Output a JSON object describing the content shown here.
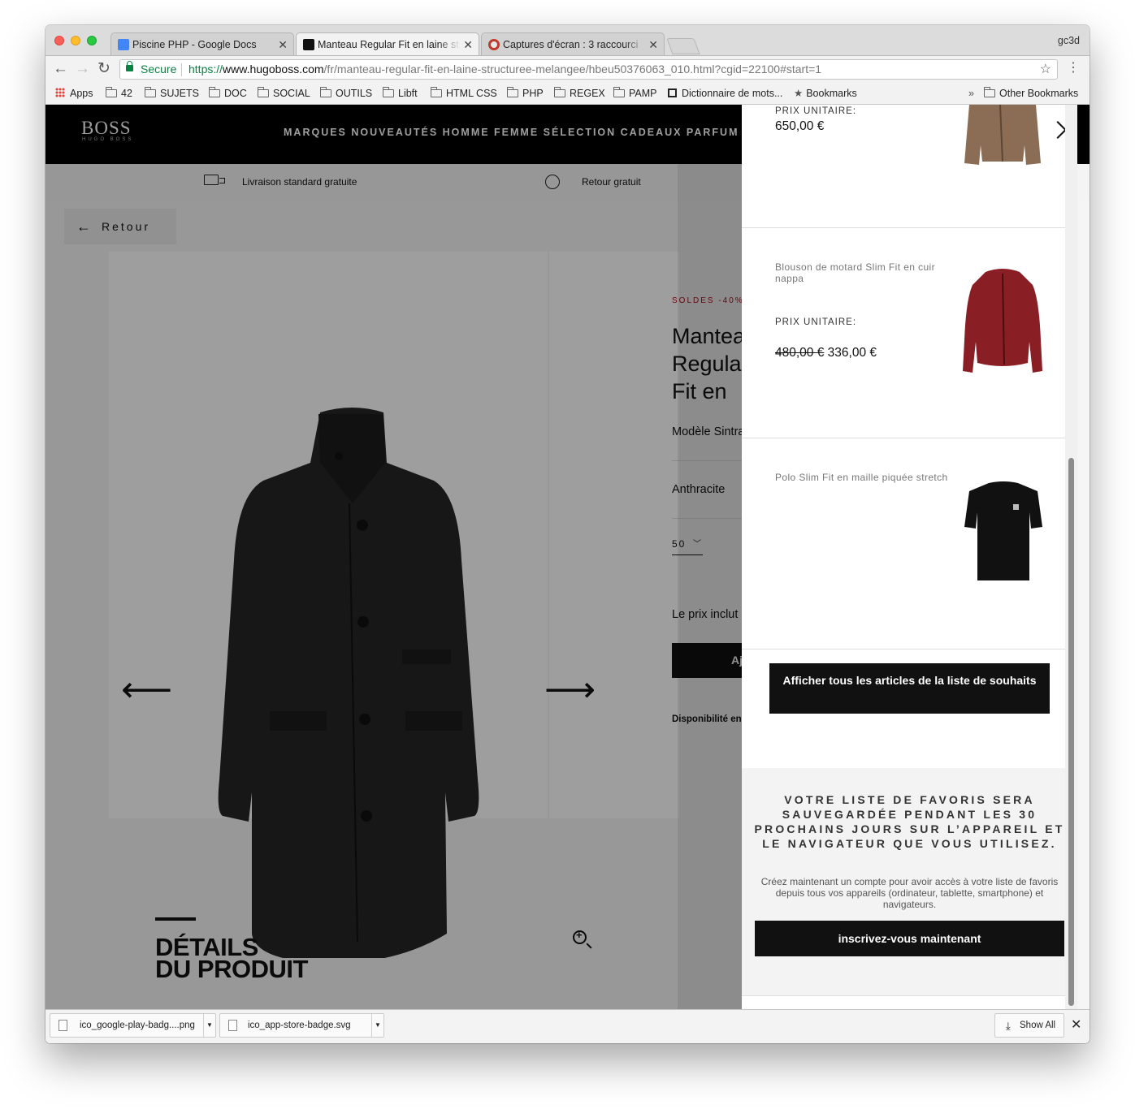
{
  "browser": {
    "tabs": [
      {
        "title": "Piscine PHP - Google Docs",
        "favicon": "google-docs-icon",
        "active": false
      },
      {
        "title": "Manteau Regular Fit en laine st",
        "favicon": "hugo-boss-icon",
        "active": true
      },
      {
        "title": "Captures d'écran : 3 raccourci",
        "favicon": "screenshot-site-icon",
        "active": false
      }
    ],
    "tab_close_glyph": "✕",
    "profile": "gc3d",
    "secure_label": "Secure",
    "url_scheme": "https://",
    "url_host": "www.hugoboss.com",
    "url_path": "/fr/manteau-regular-fit-en-laine-structuree-melangee/hbeu50376063_010.html?cgid=22100#start=1",
    "bookmarks": [
      "Apps",
      "42",
      "SUJETS",
      "DOC",
      "SOCIAL",
      "OUTILS",
      "Libft",
      "HTML CSS",
      "PHP",
      "REGEX",
      "PAMP",
      "Dictionnaire de mots...",
      "Bookmarks"
    ],
    "overflow_glyph": "»",
    "other_bookmarks": "Other Bookmarks"
  },
  "site": {
    "logo": "BOSS",
    "logo_sub": "HUGO BOSS",
    "nav": "MARQUES NOUVEAUTÉS HOMME FEMME SÉLECTION CADEAUX PARFUM",
    "usp_delivery": "Livraison standard gratuite",
    "usp_return": "Retour gratuit",
    "back_label": "Retour",
    "product": {
      "sale_badge": "SOLDES -40%",
      "name": "Manteau Regular Fit en\nlaine structurée\nmélangée",
      "model": "Modèle Sintrax",
      "color": "Anthracite",
      "size": "50",
      "price_note": "Le prix inclut la TVA",
      "add_button": "Ajouter au panier",
      "availability": "Disponibilité en magasin"
    },
    "details_title": "DÉTAILS\nDU PRODUIT"
  },
  "wishlist": {
    "items": [
      {
        "name": "",
        "unit_label": "PRIX UNITAIRE:",
        "price": "650,00 €",
        "old_price": "",
        "thumb": "brown-leather-jacket"
      },
      {
        "name": "Blouson de motard Slim Fit en cuir nappa",
        "unit_label": "PRIX UNITAIRE:",
        "price": "336,00 €",
        "old_price": "480,00 €",
        "thumb": "red-biker-jacket"
      },
      {
        "name": "Polo Slim Fit en maille piquée stretch",
        "unit_label": "",
        "price": "",
        "old_price": "",
        "thumb": "black-polo-shirt"
      }
    ],
    "view_all_button": "Afficher tous les articles de la liste de souhaits",
    "info_title": "VOTRE LISTE DE FAVORIS SERA SAUVEGARDÉE PENDANT LES 30 PROCHAINS JOURS SUR L’APPAREIL ET LE NAVIGATEUR QUE VOUS UTILISEZ.",
    "info_text": "Créez maintenant un compte pour avoir accès à votre liste de favoris depuis tous vos appareils (ordinateur, tablette, smartphone) et navigateurs.",
    "signup_button": "inscrivez-vous maintenant"
  },
  "downloads": {
    "items": [
      "ico_google-play-badg....png",
      "ico_app-store-badge.svg"
    ],
    "show_all": "Show All",
    "close_glyph": "✕"
  }
}
